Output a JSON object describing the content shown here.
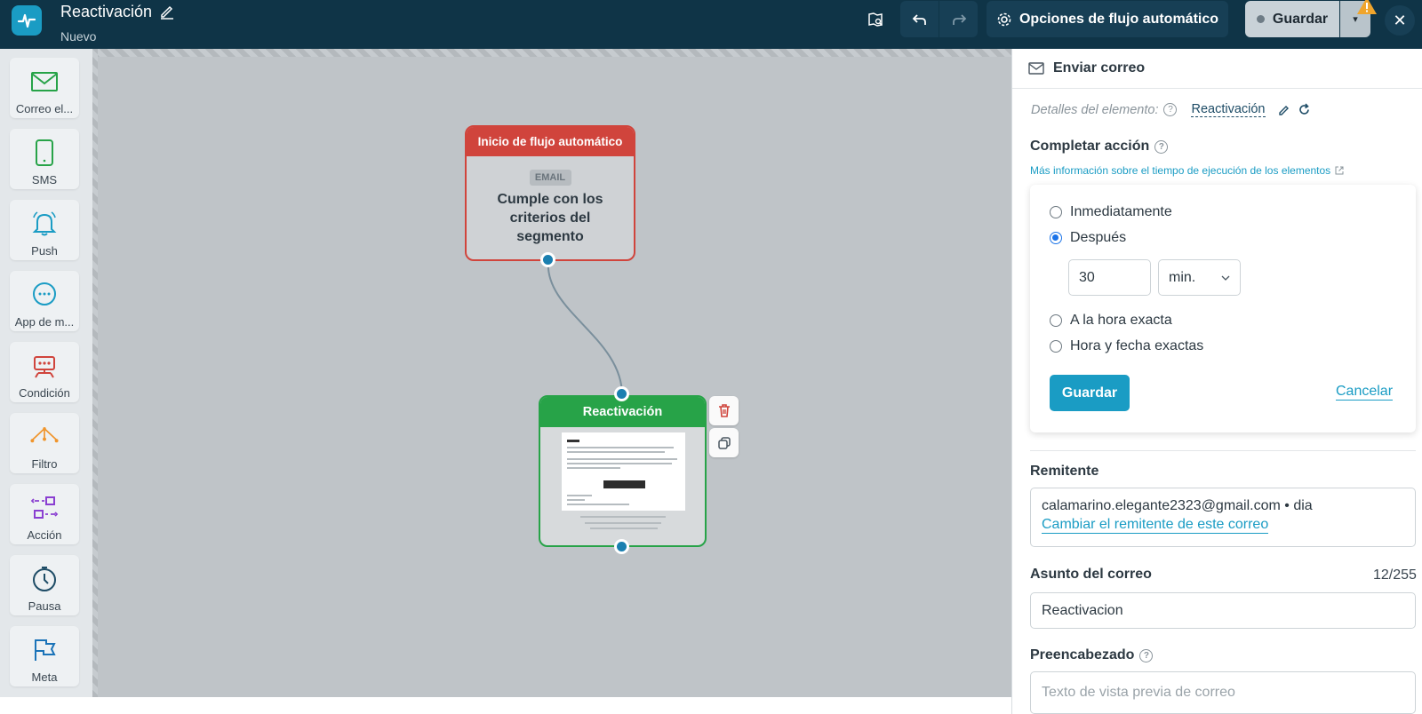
{
  "header": {
    "title": "Reactivación",
    "subtitle": "Nuevo",
    "options_label": "Opciones de flujo automático",
    "save_label": "Guardar"
  },
  "sidebar": {
    "items": [
      {
        "label": "Correo el...",
        "icon": "envelope-icon"
      },
      {
        "label": "SMS",
        "icon": "phone-icon"
      },
      {
        "label": "Push",
        "icon": "bell-icon"
      },
      {
        "label": "App de m...",
        "icon": "chat-icon"
      },
      {
        "label": "Condición",
        "icon": "robot-icon"
      },
      {
        "label": "Filtro",
        "icon": "filter-icon"
      },
      {
        "label": "Acción",
        "icon": "action-icon"
      },
      {
        "label": "Pausa",
        "icon": "clock-icon"
      },
      {
        "label": "Meta",
        "icon": "flag-icon"
      }
    ]
  },
  "canvas": {
    "start_node": {
      "title": "Inicio de flujo automático",
      "badge": "EMAIL",
      "text": "Cumple con los criterios del segmento"
    },
    "email_node": {
      "title": "Reactivación"
    }
  },
  "panel": {
    "title": "Enviar correo",
    "details_label": "Detalles del elemento:",
    "details_value": "Reactivación",
    "complete_action": {
      "title": "Completar acción",
      "info_link": "Más información sobre el tiempo de ejecución de los elementos",
      "options": [
        "Inmediatamente",
        "Después",
        "A la hora exacta",
        "Hora y fecha exactas"
      ],
      "selected": "Después",
      "delay_value": "30",
      "delay_unit": "min.",
      "save_label": "Guardar",
      "cancel_label": "Cancelar"
    },
    "sender": {
      "title": "Remitente",
      "value": "calamarino.elegante2323@gmail.com • dia",
      "change_link": "Cambiar el remitente de este correo"
    },
    "subject": {
      "title": "Asunto del correo",
      "counter": "12/255",
      "value": "Reactivacion"
    },
    "preheader": {
      "title": "Preencabezado",
      "placeholder": "Texto de vista previa de correo"
    }
  },
  "colors": {
    "topbar": "#0f3447",
    "accent": "#1a9cc4",
    "start_node": "#d0443c",
    "email_node": "#27a348"
  }
}
